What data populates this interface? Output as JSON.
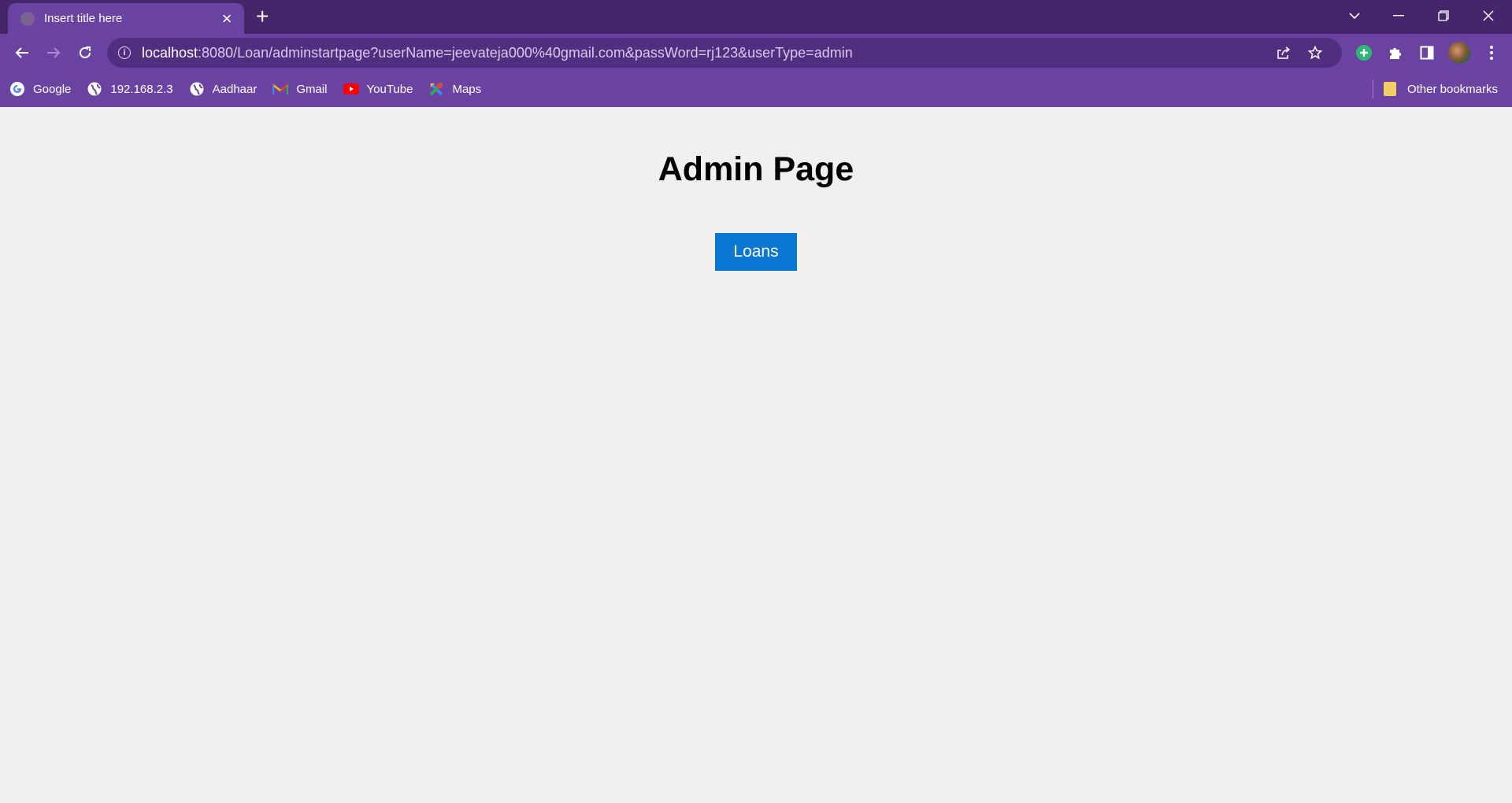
{
  "browser": {
    "tab": {
      "title": "Insert title here"
    },
    "address": {
      "host": "localhost",
      "path": ":8080/Loan/adminstartpage?userName=jeevateja000%40gmail.com&passWord=rj123&userType=admin"
    },
    "bookmarks": [
      {
        "label": "Google",
        "icon": "google-icon"
      },
      {
        "label": "192.168.2.3",
        "icon": "globe-icon"
      },
      {
        "label": "Aadhaar",
        "icon": "globe-icon"
      },
      {
        "label": "Gmail",
        "icon": "gmail-icon"
      },
      {
        "label": "YouTube",
        "icon": "youtube-icon"
      },
      {
        "label": "Maps",
        "icon": "maps-icon"
      }
    ],
    "other_bookmarks": "Other bookmarks",
    "colors": {
      "frame": "#45266b",
      "toolbar": "#6b44a3"
    }
  },
  "page": {
    "title": "Admin Page",
    "loans_button": "Loans",
    "colors": {
      "background": "#f0f0f0",
      "button": "#0a78d2"
    }
  }
}
